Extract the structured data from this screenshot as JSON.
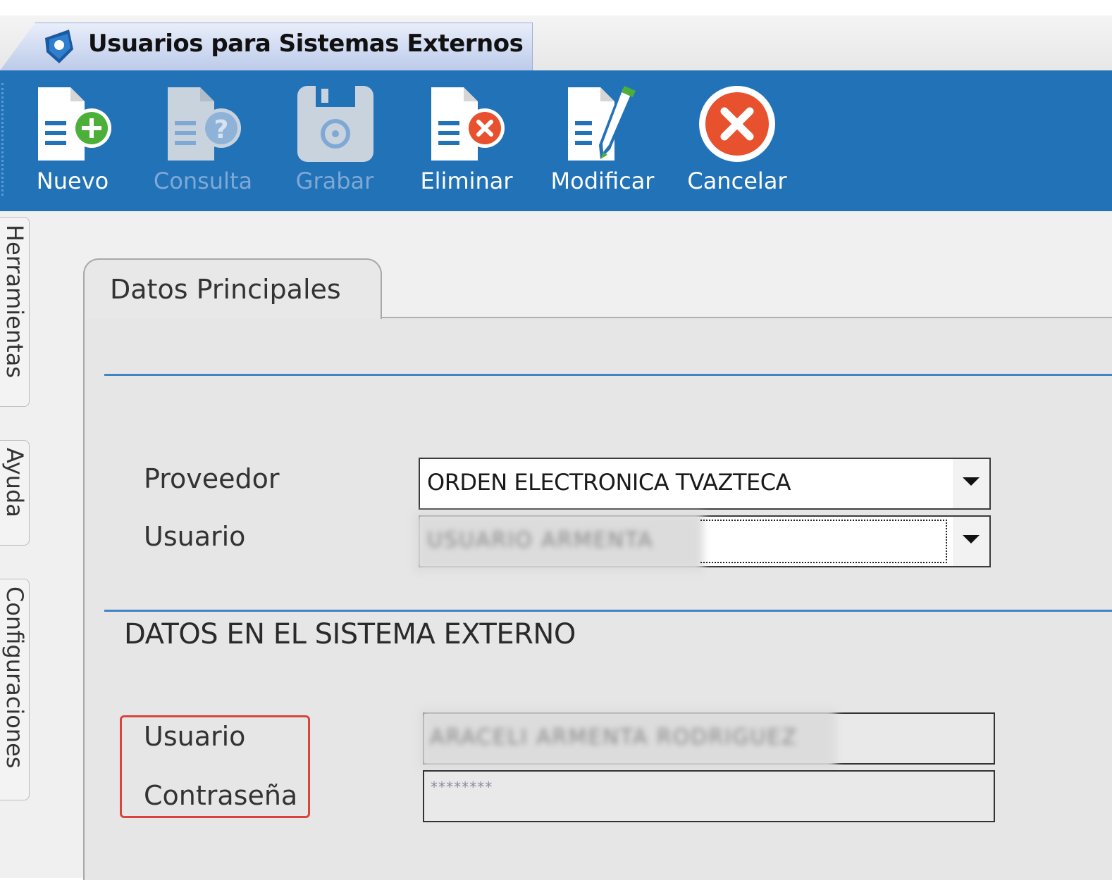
{
  "window": {
    "title": "Usuarios para Sistemas Externos"
  },
  "toolbar": {
    "buttons": [
      {
        "label": "Nuevo",
        "icon": "new-document-icon",
        "enabled": true
      },
      {
        "label": "Consulta",
        "icon": "query-document-icon",
        "enabled": false
      },
      {
        "label": "Grabar",
        "icon": "save-disk-icon",
        "enabled": false
      },
      {
        "label": "Eliminar",
        "icon": "delete-document-icon",
        "enabled": true
      },
      {
        "label": "Modificar",
        "icon": "edit-document-icon",
        "enabled": true
      },
      {
        "label": "Cancelar",
        "icon": "cancel-circle-icon",
        "enabled": true
      }
    ]
  },
  "side_tabs": [
    "Herramientas",
    "Ayuda",
    "Configuraciones"
  ],
  "main": {
    "tab_label": "Datos Principales",
    "proveedor_label": "Proveedor",
    "proveedor_value": "ORDEN ELECTRONICA TVAZTECA",
    "usuario_label": "Usuario",
    "usuario_value": "USUARIO ARMENTA",
    "section_title": "DATOS EN EL SISTEMA EXTERNO",
    "ext_usuario_label": "Usuario",
    "ext_usuario_value": "ARACELI ARMENTA RODRIGUEZ",
    "ext_password_label": "Contraseña",
    "ext_password_value": "********"
  },
  "colors": {
    "toolbar": "#2272b8",
    "accent_line": "#3f84c4",
    "highlight": "#d9453d",
    "disabled_label": "#7fa9d4"
  }
}
